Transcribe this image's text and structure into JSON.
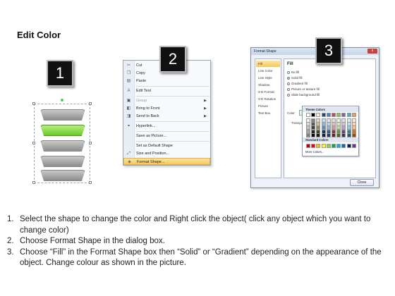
{
  "title": "Edit Color",
  "badges": [
    "1",
    "2",
    "3"
  ],
  "context_menu": {
    "items": [
      {
        "label": "Cut",
        "icon": "scissors-icon",
        "underline": "t"
      },
      {
        "label": "Copy",
        "icon": "copy-icon"
      },
      {
        "label": "Paste",
        "icon": "paste-icon"
      },
      {
        "label": "Edit Text",
        "icon": "edit-text-icon"
      },
      {
        "label": "Group",
        "icon": "group-icon",
        "disabled": true,
        "submenu": true
      },
      {
        "label": "Bring to Front",
        "icon": "bring-front-icon",
        "submenu": true
      },
      {
        "label": "Send to Back",
        "icon": "send-back-icon",
        "submenu": true
      },
      {
        "label": "Hyperlink...",
        "icon": "hyperlink-icon"
      },
      {
        "label": "Save as Picture...",
        "icon": "picture-icon"
      },
      {
        "label": "Set as Default Shape",
        "icon": "default-shape-icon"
      },
      {
        "label": "Size and Position...",
        "icon": "size-icon"
      },
      {
        "label": "Format Shape...",
        "icon": "format-shape-icon",
        "highlighted": true
      }
    ]
  },
  "format_dialog": {
    "title": "Format Shape",
    "close_label": "x",
    "nav_items": [
      "Fill",
      "Line Color",
      "Line Style",
      "Shadow",
      "3-D Format",
      "3-D Rotation",
      "Picture",
      "Text Box"
    ],
    "pane_heading": "Fill",
    "fill_options": [
      "No fill",
      "Solid fill",
      "Gradient fill",
      "Picture or texture fill",
      "Slide background fill"
    ],
    "selected_fill": "Solid fill",
    "color_label": "Color:",
    "transparency_label": "Transpa",
    "close_button": "Close",
    "palette": {
      "theme_label": "Theme Colors",
      "standard_label": "Standard Colors",
      "more_label": "More Colors...",
      "theme_top": [
        "#ffffff",
        "#000000",
        "#eeece1",
        "#1f497d",
        "#4f81bd",
        "#c0504d",
        "#9bbb59",
        "#8064a2",
        "#4bacc6",
        "#f79646"
      ],
      "theme_shades": [
        [
          "#f2f2f2",
          "#7f7f7f",
          "#ddd9c3",
          "#c6d9f0",
          "#dbe5f1",
          "#f2dcdb",
          "#ebf1dd",
          "#e5e0ec",
          "#dbeef3",
          "#fdeada"
        ],
        [
          "#d8d8d8",
          "#595959",
          "#c4bd97",
          "#8db3e2",
          "#b8cce4",
          "#e5b9b7",
          "#d7e3bc",
          "#ccc1d9",
          "#b7dde8",
          "#fbd5b5"
        ],
        [
          "#bfbfbf",
          "#3f3f3f",
          "#938953",
          "#548dd4",
          "#95b3d7",
          "#d99694",
          "#c3d69b",
          "#b2a2c7",
          "#92cddc",
          "#fac08f"
        ],
        [
          "#a5a5a5",
          "#262626",
          "#494429",
          "#17365d",
          "#366092",
          "#953734",
          "#76923c",
          "#5f497a",
          "#31859b",
          "#e36c09"
        ],
        [
          "#7f7f7f",
          "#0c0c0c",
          "#1d1b10",
          "#0f243e",
          "#244061",
          "#632423",
          "#4f6128",
          "#3f3151",
          "#205867",
          "#974806"
        ]
      ],
      "standard": [
        "#c00000",
        "#ff0000",
        "#ffc000",
        "#ffff00",
        "#92d050",
        "#00b050",
        "#00b0f0",
        "#0070c0",
        "#002060",
        "#7030a0"
      ]
    }
  },
  "shape_colors": {
    "grey": "#a8a8a8",
    "selected_green": "#7ed63c"
  },
  "steps": [
    {
      "num": "1.",
      "text": "Select the shape to change the color and Right click the object( click any object which you want to change color)"
    },
    {
      "num": "2.",
      "text": "Choose Format Shape in the dialog box."
    },
    {
      "num": "3.",
      "text": "Choose “Fill” in the Format Shape box then “Solid” or “Gradient” depending on the appearance of the object. Change colour as shown in the picture."
    }
  ]
}
